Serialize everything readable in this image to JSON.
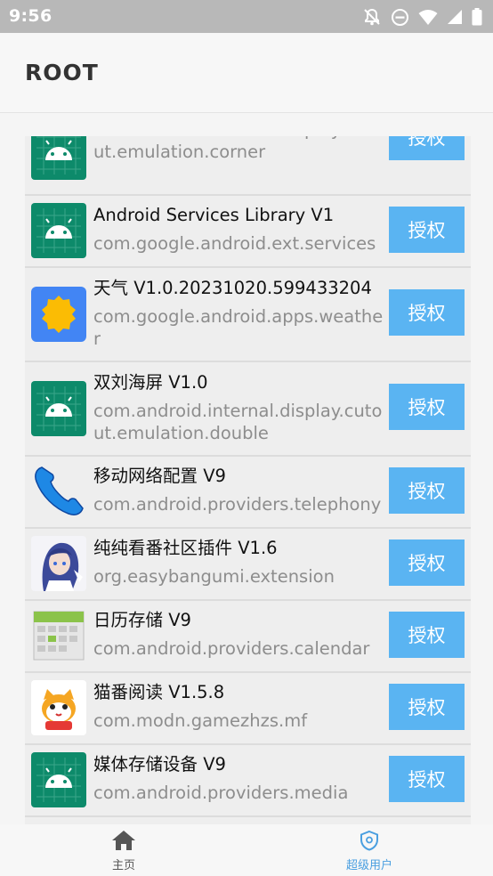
{
  "status_bar": {
    "time": "9:56",
    "icons": [
      "notifications-off-icon",
      "do-not-disturb-icon",
      "wifi-icon",
      "signal-icon",
      "battery-icon"
    ]
  },
  "app_bar": {
    "title": "ROOT"
  },
  "apps": [
    {
      "name": "",
      "package": "com.android.internal.display.cutout.emulation.corner",
      "icon": "android-icon",
      "button": "授权"
    },
    {
      "name": "Android Services Library  V1",
      "package": "com.google.android.ext.services",
      "icon": "android-icon",
      "button": "授权"
    },
    {
      "name": "天气  V1.0.20231020.599433204",
      "package": "com.google.android.apps.weather",
      "icon": "weather-sun-icon",
      "button": "授权"
    },
    {
      "name": "双刘海屏  V1.0",
      "package": "com.android.internal.display.cutout.emulation.double",
      "icon": "android-icon",
      "button": "授权"
    },
    {
      "name": "移动网络配置  V9",
      "package": "com.android.providers.telephony",
      "icon": "phone-icon",
      "button": "授权"
    },
    {
      "name": "纯纯看番社区插件  V1.6",
      "package": "org.easybangumi.extension",
      "icon": "anime-character-icon",
      "button": "授权"
    },
    {
      "name": "日历存储  V9",
      "package": "com.android.providers.calendar",
      "icon": "calendar-icon",
      "button": "授权"
    },
    {
      "name": "猫番阅读  V1.5.8",
      "package": "com.modn.gamezhzs.mf",
      "icon": "cat-icon",
      "button": "授权"
    },
    {
      "name": "媒体存储设备  V9",
      "package": "com.android.providers.media",
      "icon": "android-icon",
      "button": "授权"
    }
  ],
  "bottom_nav": {
    "items": [
      {
        "label": "主页",
        "icon": "home-icon",
        "active": false
      },
      {
        "label": "超级用户",
        "icon": "shield-icon",
        "active": true
      }
    ]
  },
  "colors": {
    "accent": "#5ab4f2",
    "nav_active": "#4a9fe0",
    "android_tile": "#0d8a6a",
    "status_bar": "#b8b8b8"
  }
}
